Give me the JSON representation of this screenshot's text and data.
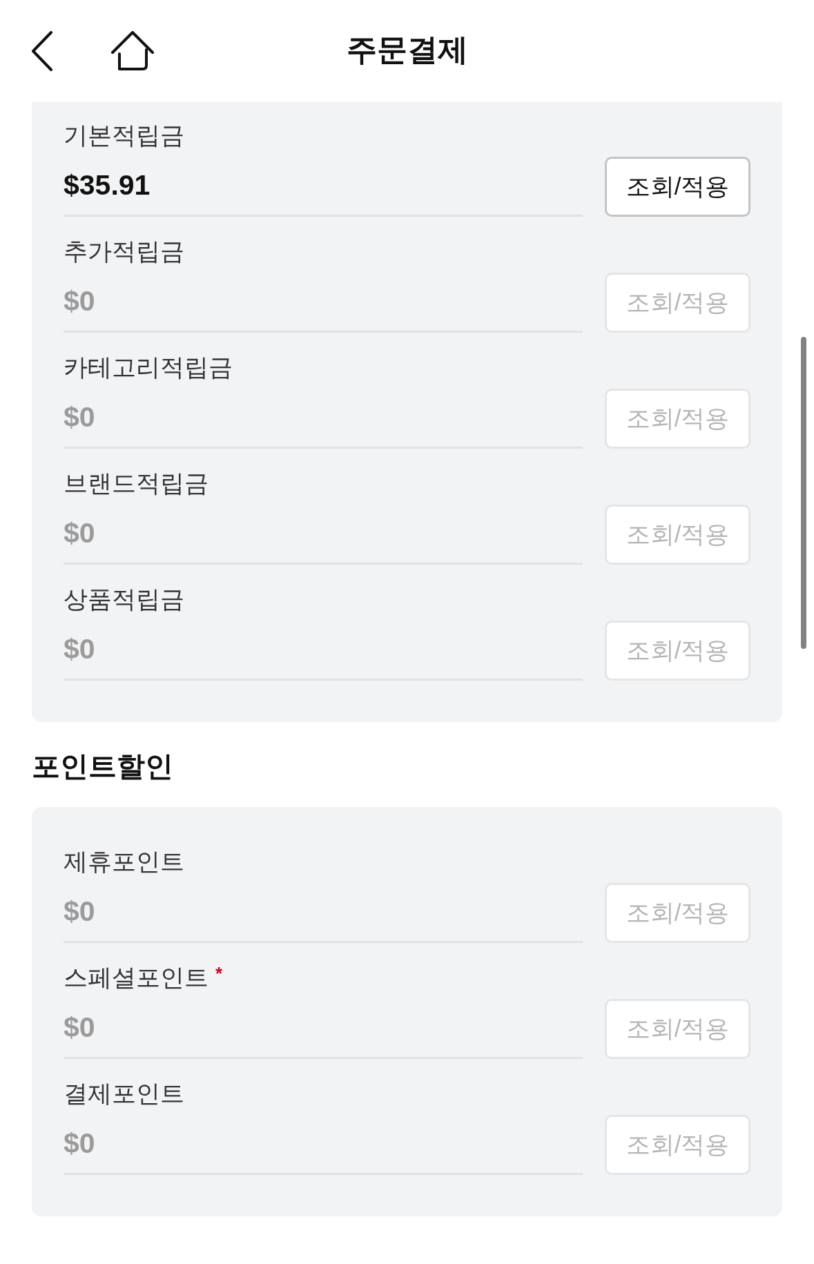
{
  "header": {
    "title": "주문결제"
  },
  "sections": [
    {
      "rows": [
        {
          "label": "기본적립금",
          "value": "$35.91",
          "disabled": false,
          "button": "조회/적용"
        },
        {
          "label": "추가적립금",
          "value": "$0",
          "disabled": true,
          "button": "조회/적용"
        },
        {
          "label": "카테고리적립금",
          "value": "$0",
          "disabled": true,
          "button": "조회/적용"
        },
        {
          "label": "브랜드적립금",
          "value": "$0",
          "disabled": true,
          "button": "조회/적용"
        },
        {
          "label": "상품적립금",
          "value": "$0",
          "disabled": true,
          "button": "조회/적용"
        }
      ]
    },
    {
      "heading": "포인트할인",
      "rows": [
        {
          "label": "제휴포인트",
          "value": "$0",
          "disabled": true,
          "button": "조회/적용"
        },
        {
          "label": "스페셜포인트",
          "marker": "*",
          "value": "$0",
          "disabled": true,
          "button": "조회/적용"
        },
        {
          "label": "결제포인트",
          "value": "$0",
          "disabled": true,
          "button": "조회/적용"
        }
      ]
    }
  ]
}
